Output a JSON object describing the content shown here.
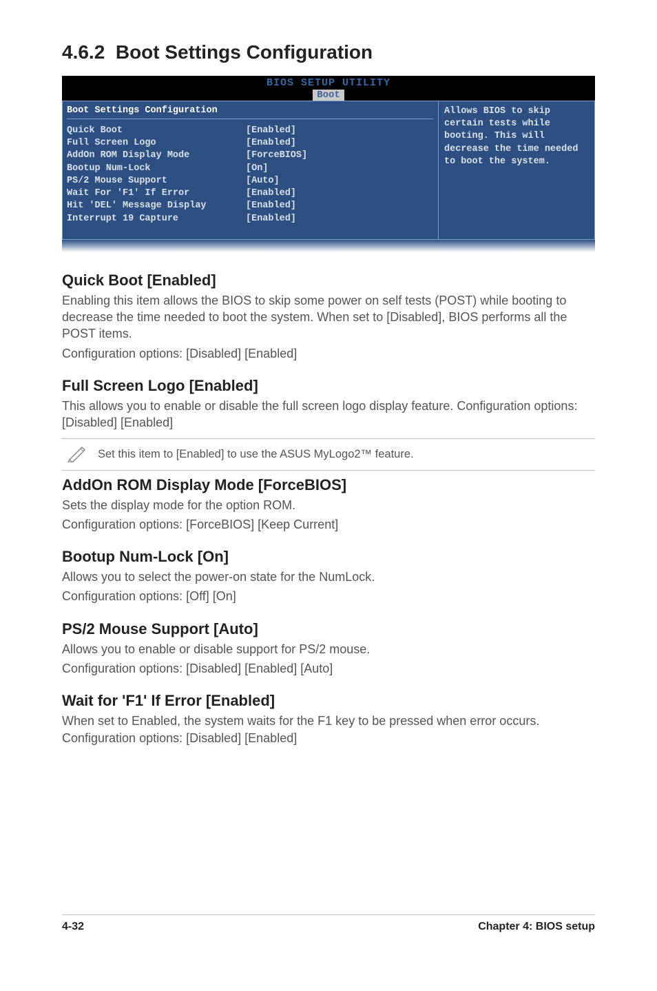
{
  "section": {
    "number": "4.6.2",
    "title": "Boot Settings Configuration"
  },
  "bios": {
    "header_title": "BIOS SETUP UTILITY",
    "header_tab": "Boot",
    "panel_title": "Boot Settings Configuration",
    "rows": [
      {
        "label": "Quick Boot",
        "value": "[Enabled]"
      },
      {
        "label": "Full Screen Logo",
        "value": "[Enabled]"
      },
      {
        "label": "AddOn ROM Display Mode",
        "value": "[ForceBIOS]"
      },
      {
        "label": "Bootup Num-Lock",
        "value": "[On]"
      },
      {
        "label": "PS/2 Mouse Support",
        "value": "[Auto]"
      },
      {
        "label": "Wait For 'F1' If Error",
        "value": "[Enabled]"
      },
      {
        "label": "Hit 'DEL' Message Display",
        "value": "[Enabled]"
      },
      {
        "label": "Interrupt 19 Capture",
        "value": "[Enabled]"
      }
    ],
    "help": "Allows BIOS to skip certain tests while booting. This will decrease the time needed to boot the system."
  },
  "settings": [
    {
      "heading": "Quick Boot [Enabled]",
      "paras": [
        "Enabling this item allows the BIOS to skip some power on self tests (POST) while booting to decrease the time needed to boot the system. When set to [Disabled], BIOS performs all the POST items.",
        "Configuration options: [Disabled] [Enabled]"
      ]
    },
    {
      "heading": "Full Screen Logo [Enabled]",
      "paras": [
        "This allows you to enable or disable the full screen logo display feature. Configuration options: [Disabled] [Enabled]"
      ],
      "note": "Set this item to [Enabled] to use the ASUS MyLogo2™ feature."
    },
    {
      "heading": "AddOn ROM Display Mode [ForceBIOS]",
      "paras": [
        "Sets the display mode for the option ROM.",
        "Configuration options: [ForceBIOS] [Keep Current]"
      ]
    },
    {
      "heading": "Bootup Num-Lock [On]",
      "paras": [
        "Allows you to select the power-on state for the NumLock.",
        "Configuration options: [Off] [On]"
      ]
    },
    {
      "heading": "PS/2 Mouse Support [Auto]",
      "paras": [
        "Allows you to enable or disable support for PS/2 mouse.",
        "Configuration options: [Disabled] [Enabled] [Auto]"
      ]
    },
    {
      "heading": "Wait for 'F1' If Error [Enabled]",
      "paras": [
        "When set to Enabled, the system waits for the F1 key to be pressed when error occurs. Configuration options: [Disabled] [Enabled]"
      ]
    }
  ],
  "footer": {
    "left": "4-32",
    "right": "Chapter 4: BIOS setup"
  }
}
